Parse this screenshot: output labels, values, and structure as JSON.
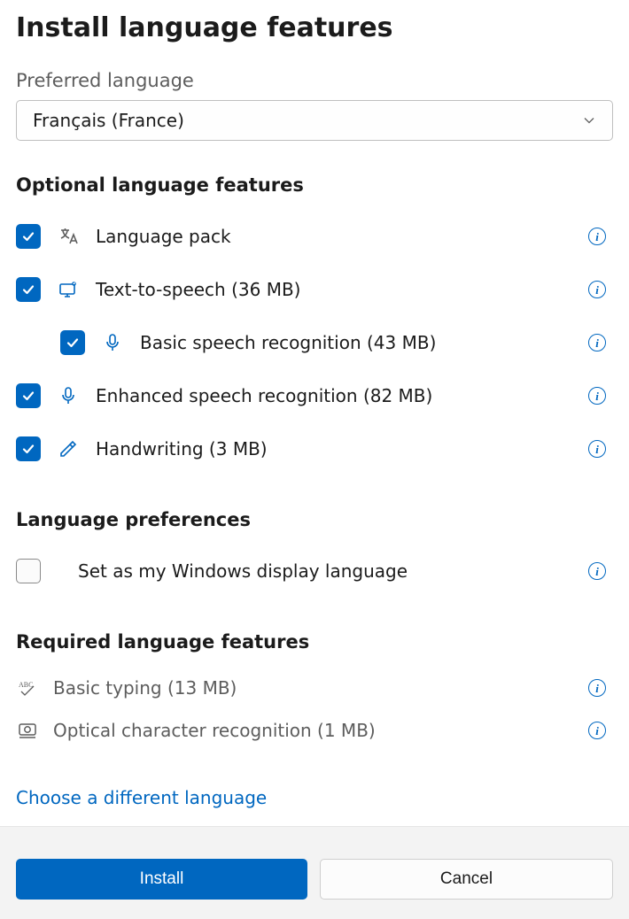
{
  "title": "Install language features",
  "preferred_language": {
    "label": "Preferred language",
    "value": "Français (France)"
  },
  "sections": {
    "optional": "Optional language features",
    "preferences": "Language preferences",
    "required": "Required language features"
  },
  "optional_features": {
    "language_pack": {
      "label": "Language pack",
      "checked": true
    },
    "tts": {
      "label": "Text-to-speech (36 MB)",
      "checked": true
    },
    "basic_speech": {
      "label": "Basic speech recognition (43 MB)",
      "checked": true
    },
    "enhanced_speech": {
      "label": "Enhanced speech recognition (82 MB)",
      "checked": true
    },
    "handwriting": {
      "label": "Handwriting (3 MB)",
      "checked": true
    }
  },
  "preferences": {
    "display_language": {
      "label": "Set as my Windows display language",
      "checked": false
    }
  },
  "required_features": {
    "basic_typing": {
      "label": "Basic typing (13 MB)"
    },
    "ocr": {
      "label": "Optical character recognition (1 MB)"
    }
  },
  "choose_different": "Choose a different language",
  "buttons": {
    "install": "Install",
    "cancel": "Cancel"
  },
  "colors": {
    "accent": "#0067c0"
  }
}
